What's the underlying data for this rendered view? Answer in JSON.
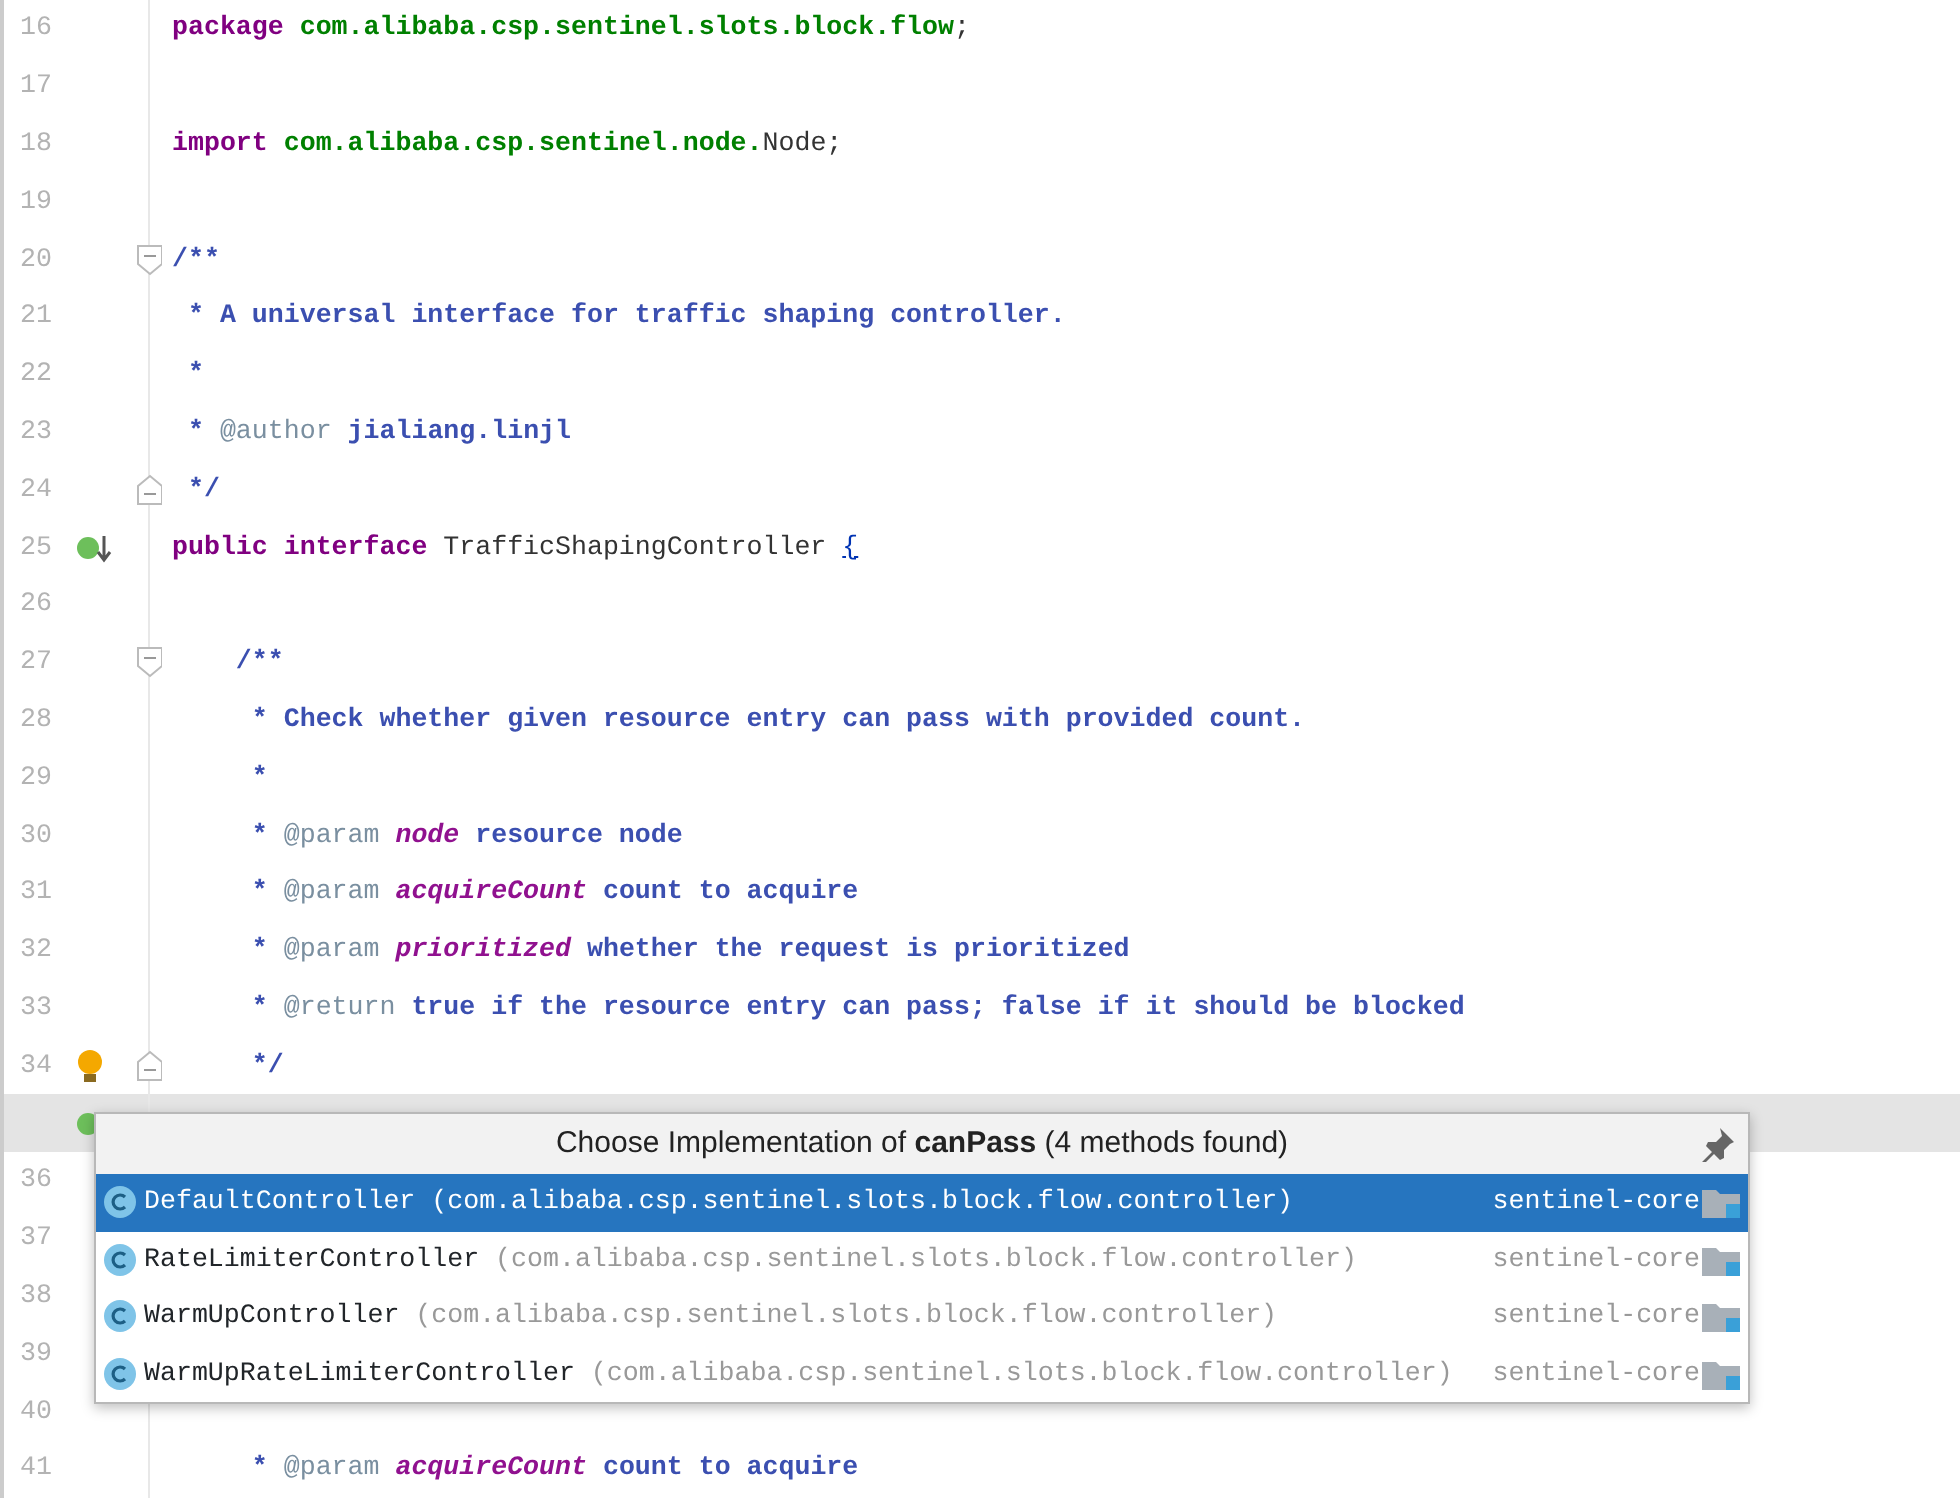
{
  "editor": {
    "lines": [
      {
        "number": "16",
        "tokens": [
          {
            "text": "package",
            "kind": "keyword"
          },
          {
            "text": " com.alibaba.csp.sentinel.slots.block.flow",
            "kind": "pkg"
          },
          {
            "text": ";",
            "kind": "plain"
          }
        ]
      },
      {
        "number": "17"
      },
      {
        "number": "18",
        "tokens": [
          {
            "text": "import",
            "kind": "keyword"
          },
          {
            "text": " com.alibaba.csp.sentinel.node.",
            "kind": "pkg"
          },
          {
            "text": "Node;",
            "kind": "plain"
          }
        ]
      },
      {
        "number": "19"
      },
      {
        "number": "20",
        "fold": {
          "kind": "open"
        },
        "tokens": [
          {
            "text": "/**",
            "kind": "doc"
          }
        ]
      },
      {
        "number": "21",
        "tokens": [
          {
            "text": " * A universal interface for traffic shaping controller.",
            "kind": "doc"
          }
        ]
      },
      {
        "number": "22",
        "tokens": [
          {
            "text": " *",
            "kind": "doc"
          }
        ]
      },
      {
        "number": "23",
        "tokens": [
          {
            "text": " * ",
            "kind": "doc"
          },
          {
            "text": "@author",
            "kind": "tag"
          },
          {
            "text": " jialiang.linjl",
            "kind": "doc"
          }
        ]
      },
      {
        "number": "24",
        "fold": {
          "kind": "close"
        },
        "tokens": [
          {
            "text": " */",
            "kind": "doc"
          }
        ]
      },
      {
        "number": "25",
        "marker": {
          "kind": "implemented"
        },
        "tokens": [
          {
            "text": "public interface",
            "kind": "keyword"
          },
          {
            "text": " TrafficShapingController ",
            "kind": "plain"
          },
          {
            "text": "{",
            "kind": "brace"
          }
        ]
      },
      {
        "number": "26"
      },
      {
        "number": "27",
        "fold": {
          "kind": "open"
        },
        "tokens": [
          {
            "text": "    /**",
            "kind": "doc"
          }
        ]
      },
      {
        "number": "28",
        "tokens": [
          {
            "text": "     * Check whether given resource entry can pass with provided count.",
            "kind": "doc"
          }
        ]
      },
      {
        "number": "29",
        "tokens": [
          {
            "text": "     *",
            "kind": "doc"
          }
        ]
      },
      {
        "number": "30",
        "tokens": [
          {
            "text": "     * ",
            "kind": "doc"
          },
          {
            "text": "@param ",
            "kind": "tag"
          },
          {
            "text": "node",
            "kind": "param"
          },
          {
            "text": " resource node",
            "kind": "doc"
          }
        ]
      },
      {
        "number": "31",
        "tokens": [
          {
            "text": "     * ",
            "kind": "doc"
          },
          {
            "text": "@param ",
            "kind": "tag"
          },
          {
            "text": "acquireCount",
            "kind": "param"
          },
          {
            "text": " count to acquire",
            "kind": "doc"
          }
        ]
      },
      {
        "number": "32",
        "tokens": [
          {
            "text": "     * ",
            "kind": "doc"
          },
          {
            "text": "@param ",
            "kind": "tag"
          },
          {
            "text": "prioritized",
            "kind": "param"
          },
          {
            "text": " whether the request is prioritized",
            "kind": "doc"
          }
        ]
      },
      {
        "number": "33",
        "tokens": [
          {
            "text": "     * ",
            "kind": "doc"
          },
          {
            "text": "@return",
            "kind": "tag"
          },
          {
            "text": " true if the resource entry can pass; false if it should be blocked",
            "kind": "doc"
          }
        ]
      },
      {
        "number": "34",
        "fold": {
          "kind": "close"
        },
        "marker": {
          "kind": "bulb"
        },
        "tokens": [
          {
            "text": "     */",
            "kind": "doc"
          }
        ]
      },
      {
        "highlighted": true,
        "marker": {
          "kind": "implemented"
        }
      },
      {
        "number": "36"
      },
      {
        "number": "37"
      },
      {
        "number": "38"
      },
      {
        "number": "39"
      },
      {
        "number": "40"
      },
      {
        "number": "41",
        "tokens": [
          {
            "text": "     * ",
            "kind": "doc"
          },
          {
            "text": "@param ",
            "kind": "tag"
          },
          {
            "text": "acquireCount",
            "kind": "param"
          },
          {
            "text": " count to acquire",
            "kind": "doc"
          }
        ]
      }
    ]
  },
  "popup": {
    "title": "Choose Implementation of **canPass** (4 methods found)",
    "items": [
      {
        "name": "DefaultController",
        "package": "(com.alibaba.csp.sentinel.slots.block.flow.controller)",
        "module": "sentinel-core",
        "selected": true
      },
      {
        "name": "RateLimiterController",
        "package": "(com.alibaba.csp.sentinel.slots.block.flow.controller)",
        "module": "sentinel-core",
        "selected": false
      },
      {
        "name": "WarmUpController",
        "package": "(com.alibaba.csp.sentinel.slots.block.flow.controller)",
        "module": "sentinel-core",
        "selected": false
      },
      {
        "name": "WarmUpRateLimiterController",
        "package": "(com.alibaba.csp.sentinel.slots.block.flow.controller)",
        "module": "sentinel-core",
        "selected": false
      }
    ]
  }
}
